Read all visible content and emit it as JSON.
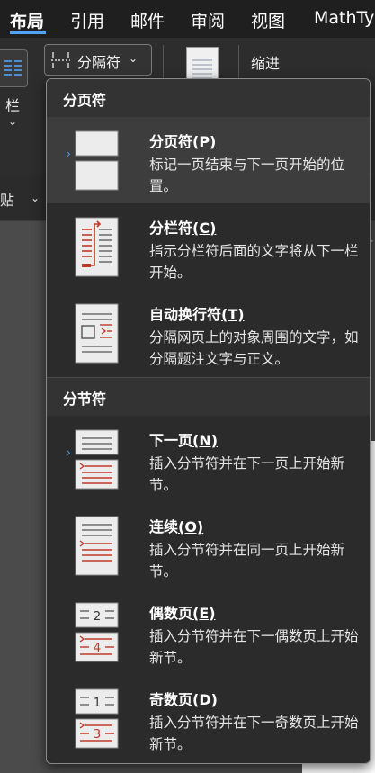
{
  "tabs": [
    "布局",
    "引用",
    "邮件",
    "审阅",
    "视图",
    "MathTy"
  ],
  "ribbon": {
    "columns_label": "栏",
    "breaks_label": "分隔符",
    "indent_label": "缩进",
    "paste_label": "贴"
  },
  "menu": {
    "page_breaks_header": "分页符",
    "section_breaks_header": "分节符",
    "items": [
      {
        "title": "分页符",
        "key": "(P)",
        "desc": "标记一页结束与下一页开始的位置。",
        "icon": "page-break-icon"
      },
      {
        "title": "分栏符",
        "key": "(C)",
        "desc": "指示分栏符后面的文字将从下一栏开始。",
        "icon": "column-break-icon"
      },
      {
        "title": "自动换行符",
        "key": "(T)",
        "desc": "分隔网页上的对象周围的文字，如分隔题注文字与正文。",
        "icon": "text-wrapping-break-icon"
      },
      {
        "title": "下一页",
        "key": "(N)",
        "desc": "插入分节符并在下一页上开始新节。",
        "icon": "next-page-section-icon"
      },
      {
        "title": "连续",
        "key": "(O)",
        "desc": "插入分节符并在同一页上开始新节。",
        "icon": "continuous-section-icon"
      },
      {
        "title": "偶数页",
        "key": "(E)",
        "desc": "插入分节符并在下一偶数页上开始新节。",
        "icon": "even-page-section-icon",
        "badge": "2",
        "badge2": "4"
      },
      {
        "title": "奇数页",
        "key": "(D)",
        "desc": "插入分节符并在下一奇数页上开始新节。",
        "icon": "odd-page-section-icon",
        "badge": "1",
        "badge2": "3"
      }
    ]
  },
  "colors": {
    "accent": "#4ea5f5",
    "break_red": "#c0392b",
    "menu_bg": "#2b2b2b"
  }
}
